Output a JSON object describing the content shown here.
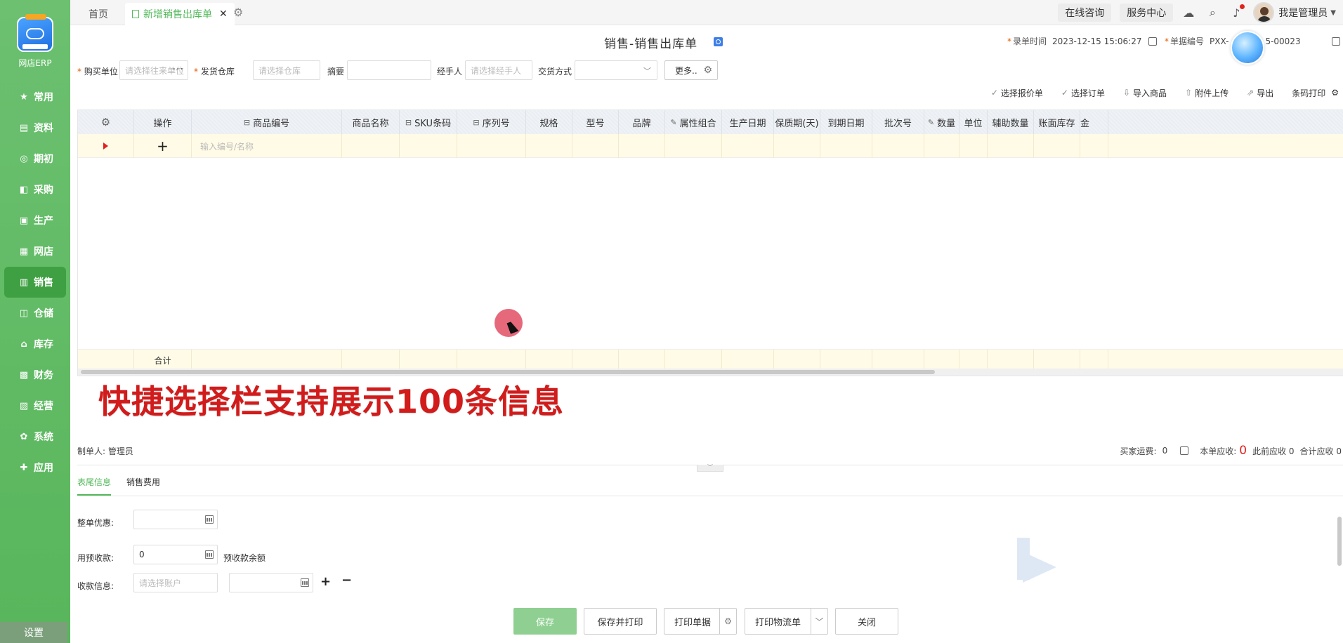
{
  "sidebar": {
    "app_name": "网店ERP",
    "items": [
      {
        "label": "常用",
        "icon": "★"
      },
      {
        "label": "资料",
        "icon": "▤"
      },
      {
        "label": "期初",
        "icon": "◎"
      },
      {
        "label": "采购",
        "icon": "◧"
      },
      {
        "label": "生产",
        "icon": "▣"
      },
      {
        "label": "网店",
        "icon": "▦"
      },
      {
        "label": "销售",
        "icon": "▥"
      },
      {
        "label": "仓储",
        "icon": "◫"
      },
      {
        "label": "库存",
        "icon": "⌂"
      },
      {
        "label": "财务",
        "icon": "▩"
      },
      {
        "label": "经营",
        "icon": "▨"
      },
      {
        "label": "系统",
        "icon": "✿"
      },
      {
        "label": "应用",
        "icon": "✚"
      }
    ],
    "settings_label": "设置"
  },
  "topbar": {
    "home_tab": "首页",
    "current_tab": "新增销售出库单",
    "close_glyph": "✕",
    "consult": "在线咨询",
    "service": "服务中心",
    "username": "我是管理员"
  },
  "header": {
    "title": "销售-销售出库单",
    "record_time_label": "录单时间",
    "record_time_value": "2023-12-15 15:06:27",
    "doc_no_label": "单据编号",
    "doc_no_prefix": "PXX-",
    "doc_no_suffix": "5-00023"
  },
  "form": {
    "buyer_label": "购买单位",
    "buyer_placeholder": "请选择往来单位",
    "warehouse_label": "发货仓库",
    "warehouse_placeholder": "请选择仓库",
    "summary_label": "摘要",
    "handler_label": "经手人",
    "handler_placeholder": "请选择经手人",
    "delivery_label": "交货方式",
    "more_label": "更多.."
  },
  "actions": [
    "选择报价单",
    "选择订单",
    "导入商品",
    "附件上传",
    "导出",
    "条码打印"
  ],
  "grid": {
    "columns": [
      "操作",
      "商品编号",
      "商品名称",
      "SKU条码",
      "序列号",
      "规格",
      "型号",
      "品牌",
      "属性组合",
      "生产日期",
      "保质期(天)",
      "到期日期",
      "批次号",
      "数量",
      "单位",
      "辅助数量",
      "账面库存",
      "金"
    ],
    "entry_placeholder": "输入编号/名称",
    "total_label": "合计"
  },
  "overlay_text": "快捷选择栏支持展示100条信息",
  "footer_summary": {
    "creator": "制单人: 管理员",
    "buyer_freight_label": "买家运费:",
    "buyer_freight_value": "0",
    "receivable_label": "本单应收:",
    "receivable_value": "0",
    "prior_receivable": "此前应收 0",
    "total_receivable": "合计应收 0"
  },
  "bottom_tabs": [
    "表尾信息",
    "销售费用"
  ],
  "bottom_fields": {
    "discount_label": "整单优惠:",
    "prepaid_label": "用预收款:",
    "prepaid_value": "0",
    "prepaid_balance_label": "预收款余额",
    "payment_label": "收款信息:",
    "account_placeholder": "请选择账户"
  },
  "buttons": {
    "save": "保存",
    "save_print": "保存并打印",
    "print_doc": "打印单据",
    "print_logistics": "打印物流单",
    "close": "关闭"
  }
}
